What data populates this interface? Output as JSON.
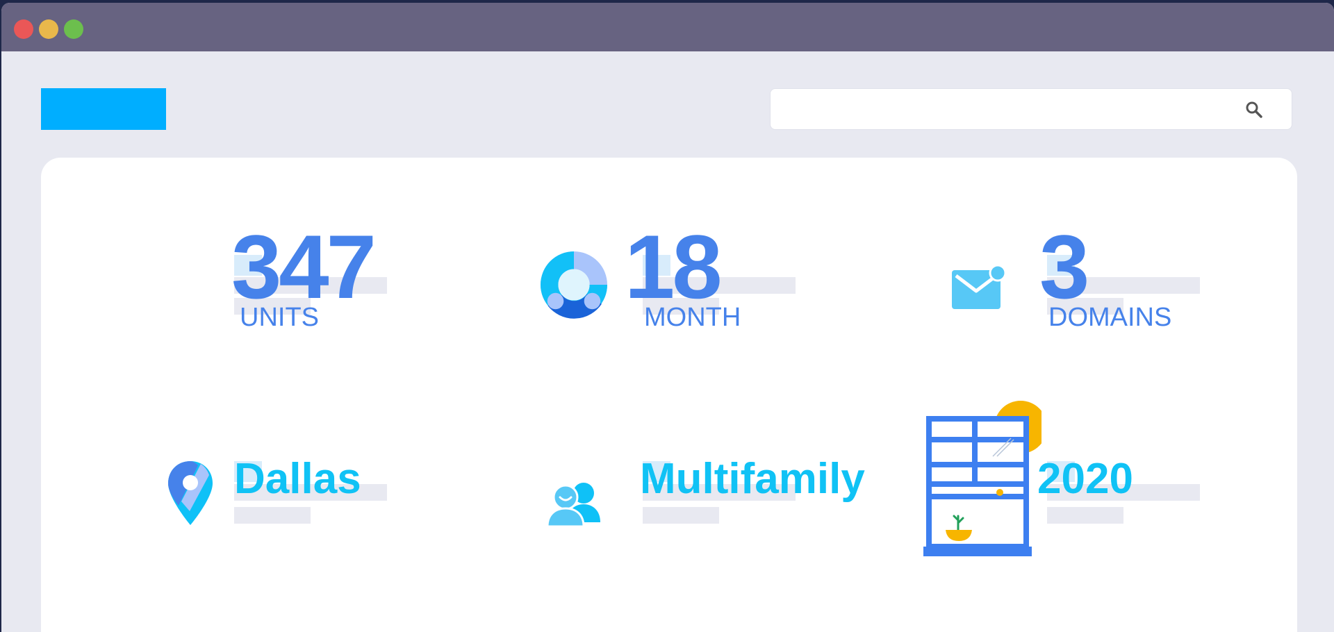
{
  "window": {
    "controls": [
      "close",
      "minimize",
      "maximize"
    ]
  },
  "header": {
    "search": {
      "value": "",
      "placeholder": "",
      "icon": "search-icon"
    }
  },
  "stats": [
    {
      "value": "347",
      "label": "UNITS",
      "icon": ""
    },
    {
      "value": "18",
      "label": "MONTH",
      "icon": "donut-chart-icon"
    },
    {
      "value": "3",
      "label": "DOMAINS",
      "icon": "mail-icon"
    }
  ],
  "details": [
    {
      "text": "Dallas",
      "icon": "location-pin-icon"
    },
    {
      "text": "Multifamily",
      "icon": "people-icon"
    },
    {
      "text": "2020",
      "icon": "window-illustration-icon"
    }
  ],
  "colors": {
    "primary_blue": "#4682ea",
    "accent_cyan": "#10c2f5",
    "brand_block": "#00aeff",
    "titlebar": "#676381",
    "page_bg": "#e8e9f1",
    "sun": "#f7b500"
  }
}
